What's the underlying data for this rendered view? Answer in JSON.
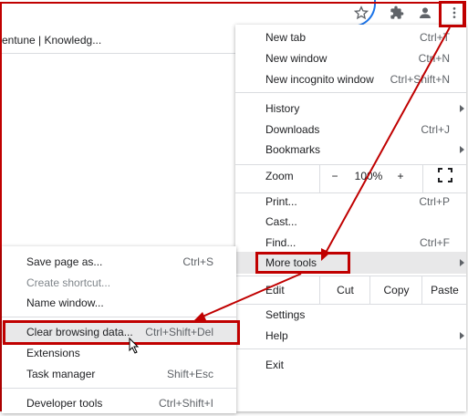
{
  "browser": {
    "tab_title": "entune | Knowledg...",
    "toolbar_icons": [
      "star-icon",
      "extensions-puzzle-icon",
      "profile-icon",
      "more-vertical-icon"
    ]
  },
  "main_menu": {
    "new_tab": "New tab",
    "new_tab_sc": "Ctrl+T",
    "new_window": "New window",
    "new_window_sc": "Ctrl+N",
    "incognito": "New incognito window",
    "incognito_sc": "Ctrl+Shift+N",
    "history": "History",
    "downloads": "Downloads",
    "downloads_sc": "Ctrl+J",
    "bookmarks": "Bookmarks",
    "zoom_label": "Zoom",
    "zoom_minus": "−",
    "zoom_value": "100%",
    "zoom_plus": "+",
    "print": "Print...",
    "print_sc": "Ctrl+P",
    "cast": "Cast...",
    "find": "Find...",
    "find_sc": "Ctrl+F",
    "more_tools": "More tools",
    "edit": "Edit",
    "cut": "Cut",
    "copy": "Copy",
    "paste": "Paste",
    "settings": "Settings",
    "help": "Help",
    "exit": "Exit"
  },
  "more_tools_menu": {
    "save_page": "Save page as...",
    "save_page_sc": "Ctrl+S",
    "create_shortcut": "Create shortcut...",
    "name_window": "Name window...",
    "clear_data": "Clear browsing data...",
    "clear_data_sc": "Ctrl+Shift+Del",
    "extensions": "Extensions",
    "task_manager": "Task manager",
    "task_manager_sc": "Shift+Esc",
    "developer_tools": "Developer tools",
    "developer_tools_sc": "Ctrl+Shift+I"
  },
  "colors": {
    "highlight": "#c00000",
    "menu_hover": "#e8e8e9",
    "focus_blue": "#1a73e8"
  }
}
